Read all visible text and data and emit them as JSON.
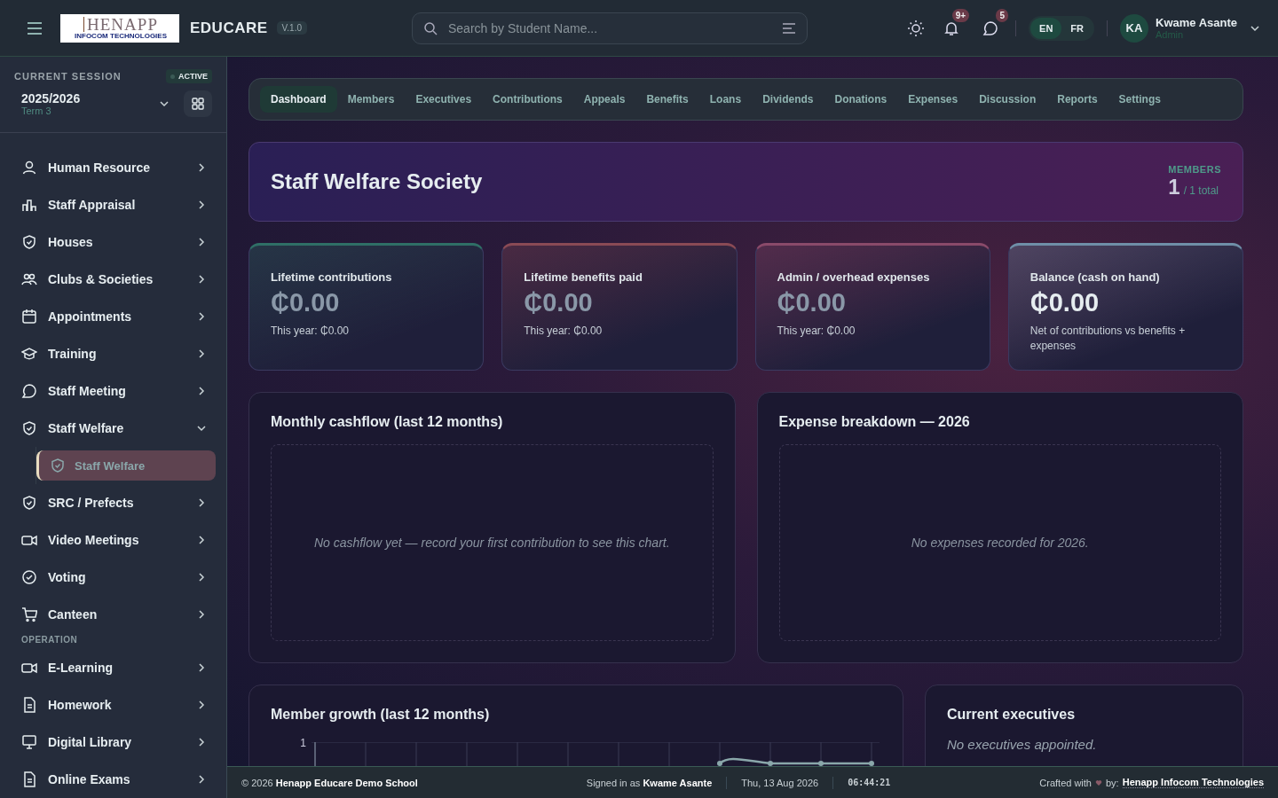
{
  "header": {
    "logo": {
      "name": "HENAPP",
      "tagline": "INFOCOM TECHNOLOGIES"
    },
    "app_name": "EDUCARE",
    "version": "V.1.0",
    "search": {
      "placeholder": "Search by Student Name..."
    },
    "notifications_badge": "9+",
    "messages_badge": "5",
    "languages": [
      {
        "label": "EN",
        "selected": true
      },
      {
        "label": "FR",
        "selected": false
      }
    ],
    "user": {
      "initials": "KA",
      "name": "Kwame Asante",
      "role": "Admin"
    }
  },
  "sidebar": {
    "session_label": "CURRENT SESSION",
    "status": "ACTIVE",
    "session": "2025/2026",
    "term": "Term 3",
    "items": [
      {
        "kind": "item",
        "label": "Human Resource",
        "expanded": false
      },
      {
        "kind": "item",
        "label": "Staff Appraisal",
        "expanded": false
      },
      {
        "kind": "item",
        "label": "Houses",
        "expanded": false
      },
      {
        "kind": "item",
        "label": "Clubs & Societies",
        "expanded": false
      },
      {
        "kind": "item",
        "label": "Appointments",
        "expanded": false
      },
      {
        "kind": "item",
        "label": "Training",
        "expanded": false
      },
      {
        "kind": "item",
        "label": "Staff Meeting",
        "expanded": false
      },
      {
        "kind": "item",
        "label": "Staff Welfare",
        "expanded": true,
        "children": [
          {
            "label": "Staff Welfare",
            "selected": true
          }
        ]
      },
      {
        "kind": "item",
        "label": "SRC / Prefects",
        "expanded": false
      },
      {
        "kind": "item",
        "label": "Video Meetings",
        "expanded": false
      },
      {
        "kind": "item",
        "label": "Voting",
        "expanded": false
      },
      {
        "kind": "item",
        "label": "Canteen",
        "expanded": false
      },
      {
        "kind": "section",
        "label": "OPERATION"
      },
      {
        "kind": "item",
        "label": "E-Learning",
        "expanded": false
      },
      {
        "kind": "item",
        "label": "Homework",
        "expanded": false
      },
      {
        "kind": "item",
        "label": "Digital Library",
        "expanded": false
      },
      {
        "kind": "item",
        "label": "Online Exams",
        "expanded": false
      }
    ]
  },
  "tabs": [
    {
      "label": "Dashboard",
      "selected": true
    },
    {
      "label": "Members",
      "selected": false
    },
    {
      "label": "Executives",
      "selected": false
    },
    {
      "label": "Contributions",
      "selected": false
    },
    {
      "label": "Appeals",
      "selected": false
    },
    {
      "label": "Benefits",
      "selected": false
    },
    {
      "label": "Loans",
      "selected": false
    },
    {
      "label": "Dividends",
      "selected": false
    },
    {
      "label": "Donations",
      "selected": false
    },
    {
      "label": "Expenses",
      "selected": false
    },
    {
      "label": "Discussion",
      "selected": false
    },
    {
      "label": "Reports",
      "selected": false
    },
    {
      "label": "Settings",
      "selected": false
    }
  ],
  "banner": {
    "title": "Staff Welfare Society",
    "members_label": "MEMBERS",
    "members_count": "1",
    "members_total": "/ 1 total"
  },
  "stats": [
    {
      "label": "Lifetime contributions",
      "value": "₵0.00",
      "note": "This year: ₵0.00",
      "color": "#2f6f66"
    },
    {
      "label": "Lifetime benefits paid",
      "value": "₵0.00",
      "note": "This year: ₵0.00",
      "color": "#8a4a55"
    },
    {
      "label": "Admin / overhead expenses",
      "value": "₵0.00",
      "note": "This year: ₵0.00",
      "color": "#8a4a6a"
    },
    {
      "label": "Balance (cash on hand)",
      "value": "₵0.00",
      "note": "Net of contributions vs benefits + expenses",
      "color": "#6f8fa8"
    }
  ],
  "cashflow": {
    "title": "Monthly cashflow (last 12 months)",
    "empty": "No cashflow yet — record your first contribution to see this chart."
  },
  "expenses": {
    "title": "Expense breakdown — 2026",
    "empty": "No expenses recorded for 2026."
  },
  "growth": {
    "title": "Member growth (last 12 months)",
    "y_tick": "1"
  },
  "executives": {
    "title": "Current executives",
    "empty": "No executives appointed."
  },
  "footer": {
    "copyright": "© 2026 **Henapp Educare Demo School**",
    "signed_in": "Signed in as **Kwame Asante**",
    "date": "Thu, 13 Aug 2026",
    "time": "06:44:21",
    "crafted": "Crafted with",
    "by": "by:",
    "company": "Henapp Infocom Technologies"
  }
}
